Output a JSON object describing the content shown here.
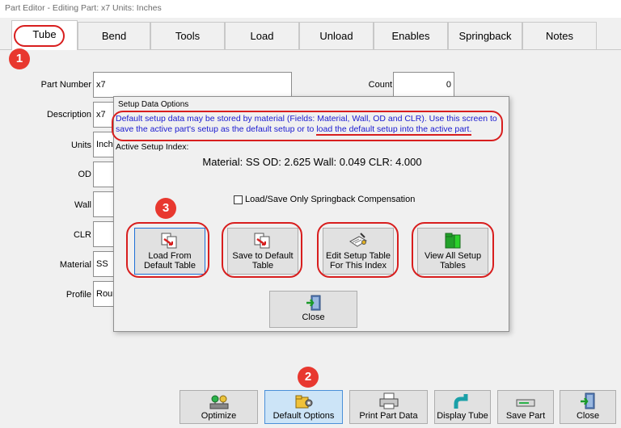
{
  "window": {
    "title": "Part Editor - Editing Part: x7  Units: Inches"
  },
  "tabs": [
    {
      "label": "Tube"
    },
    {
      "label": "Bend"
    },
    {
      "label": "Tools"
    },
    {
      "label": "Load"
    },
    {
      "label": "Unload"
    },
    {
      "label": "Enables"
    },
    {
      "label": "Springback"
    },
    {
      "label": "Notes"
    }
  ],
  "form": {
    "part_number": {
      "label": "Part Number",
      "value": "x7"
    },
    "description": {
      "label": "Description",
      "value": "x7"
    },
    "units": {
      "label": "Units",
      "value": "Inche"
    },
    "od": {
      "label": "OD",
      "value": ""
    },
    "wall": {
      "label": "Wall",
      "value": ""
    },
    "clr": {
      "label": "CLR",
      "value": ""
    },
    "material": {
      "label": "Material",
      "value": "SS"
    },
    "profile": {
      "label": "Profile",
      "value": "Roun"
    },
    "count": {
      "label": "Count",
      "value": "0"
    }
  },
  "dialog": {
    "title": "Setup Data Options",
    "desc_part1": "Default setup data may be stored by material (Fields: Material, Wall, OD and CLR).   Use this screen to save the active part's setup as the default setup or to ",
    "desc_part2": "load the default setup into the active part.",
    "active_index_label": "Active Setup Index:",
    "values": "Material: SS   OD: 2.625   Wall: 0.049   CLR: 4.000",
    "checkbox_label": "Load/Save Only Springback Compensation",
    "buttons": {
      "load_default_line1": "Load From",
      "load_default_line2": "Default Table",
      "save_default_line1": "Save to Default",
      "save_default_line2": "Table",
      "edit_table_line1": "Edit Setup Table",
      "edit_table_line2": "For This Index",
      "view_all_line1": "View All Setup",
      "view_all_line2": "Tables",
      "close": "Close"
    }
  },
  "bottom_buttons": {
    "optimize": "Optimize",
    "default_options": "Default Options",
    "print_part_data": "Print Part Data",
    "display_tube": "Display Tube",
    "save_part": "Save Part",
    "close": "Close"
  },
  "badges": {
    "one": "1",
    "two": "2",
    "three": "3"
  },
  "colors": {
    "annotation_red": "#d81e1e",
    "link_blue": "#1a1ad0",
    "highlight_blue": "#cce4f7"
  }
}
